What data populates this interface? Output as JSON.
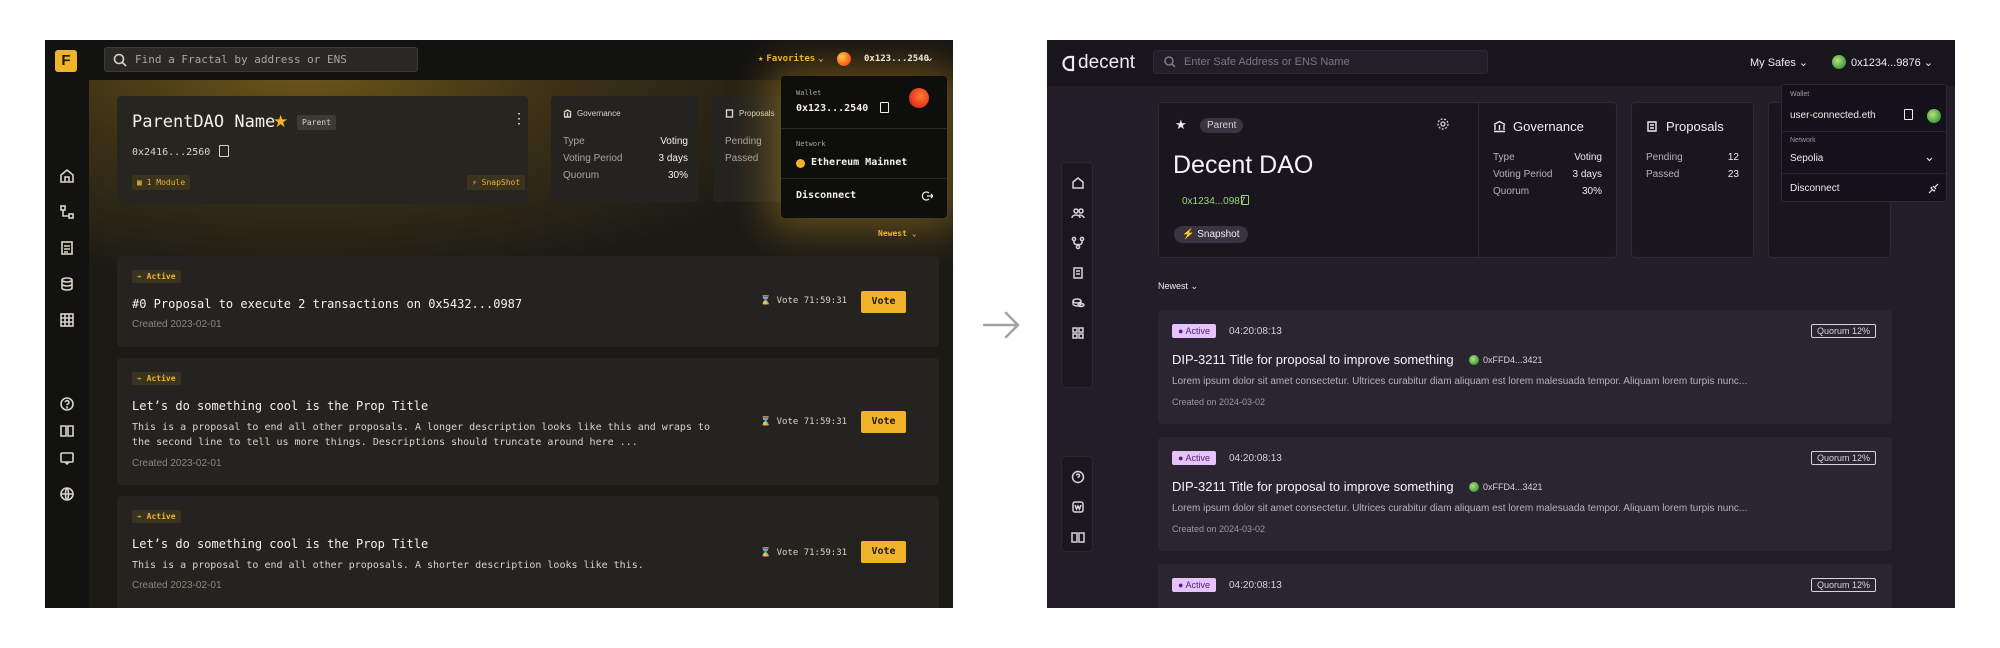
{
  "left": {
    "search_placeholder": "Find a Fractal by address or ENS",
    "favorites": "Favorites",
    "address": "0x123...2540",
    "dao": {
      "name": "ParentDAO Name",
      "badge": "Parent",
      "address": "0x2416...2560",
      "module": "1 Module",
      "snapshot": "SnapShot"
    },
    "governance": {
      "title": "Governance",
      "rows": [
        {
          "k": "Type",
          "v": "Voting"
        },
        {
          "k": "Voting Period",
          "v": "3 days"
        },
        {
          "k": "Quorum",
          "v": "30%"
        }
      ]
    },
    "proposals": {
      "title": "Proposals",
      "rows": [
        {
          "k": "Pending",
          "v": ""
        },
        {
          "k": "Passed",
          "v": ""
        }
      ]
    },
    "wallet_popup": {
      "wallet_label": "Wallet",
      "wallet_address": "0x123...2540",
      "network_label": "Network",
      "network": "Ethereum Mainnet",
      "disconnect": "Disconnect"
    },
    "sort": "Newest",
    "proposal_list": [
      {
        "status": "Active",
        "title": "#0 Proposal to execute 2 transactions on 0x5432...0987",
        "description": "",
        "created": "Created 2023-02-01",
        "vote_time": "Vote 71:59:31",
        "vote": "Vote"
      },
      {
        "status": "Active",
        "title": "Let’s do something cool is the Prop Title",
        "description": "This is a proposal to end all other proposals. A longer description looks like this and wraps to the second line to tell us more things. Descriptions should truncate around here ...",
        "created": "Created 2023-02-01",
        "vote_time": "Vote 71:59:31",
        "vote": "Vote"
      },
      {
        "status": "Active",
        "title": "Let’s do something cool is the Prop Title",
        "description": "This is a proposal to end all other proposals. A shorter description looks like this.",
        "created": "Created 2023-02-01",
        "vote_time": "Vote 71:59:31",
        "vote": "Vote"
      }
    ]
  },
  "right": {
    "logo": "decent",
    "search_placeholder": "Enter Safe Address or ENS Name",
    "my_safes": "My Safes",
    "address": "0x1234...9876",
    "dao": {
      "badge": "Parent",
      "name": "Decent DAO",
      "address": "0x1234...0987",
      "snapshot": "Snapshot"
    },
    "governance": {
      "title": "Governance",
      "rows": [
        {
          "k": "Type",
          "v": "Voting"
        },
        {
          "k": "Voting Period",
          "v": "3 days"
        },
        {
          "k": "Quorum",
          "v": "30%"
        }
      ]
    },
    "proposals": {
      "title": "Proposals",
      "rows": [
        {
          "k": "Pending",
          "v": "12"
        },
        {
          "k": "Passed",
          "v": "23"
        }
      ]
    },
    "wallet_popup": {
      "wallet_label": "Wallet",
      "wallet_value": "user-connected.eth",
      "network_label": "Network",
      "network": "Sepolia",
      "disconnect": "Disconnect"
    },
    "sort": "Newest",
    "proposal_list": [
      {
        "status": "Active",
        "time": "04:20:08:13",
        "quorum": "Quorum 12%",
        "title": "DIP-3211 Title for proposal to improve something",
        "author": "0xFFD4...3421",
        "description": "Lorem ipsum dolor sit amet consectetur. Ultrices curabitur diam aliquam est lorem malesuada tempor. Aliquam lorem turpis nunc...",
        "created": "Created on 2024-03-02"
      },
      {
        "status": "Active",
        "time": "04:20:08:13",
        "quorum": "Quorum 12%",
        "title": "DIP-3211 Title for proposal to improve something",
        "author": "0xFFD4...3421",
        "description": "Lorem ipsum dolor sit amet consectetur. Ultrices curabitur diam aliquam est lorem malesuada tempor. Aliquam lorem turpis nunc...",
        "created": "Created on 2024-03-02"
      },
      {
        "status": "Active",
        "time": "04:20:08:13",
        "quorum": "Quorum 12%",
        "title": "",
        "author": "",
        "description": "",
        "created": ""
      }
    ]
  },
  "colors": {
    "left_accent": "#f1b32a",
    "right_accent": "#e6c2ff",
    "right_address": "#9bd37a"
  }
}
